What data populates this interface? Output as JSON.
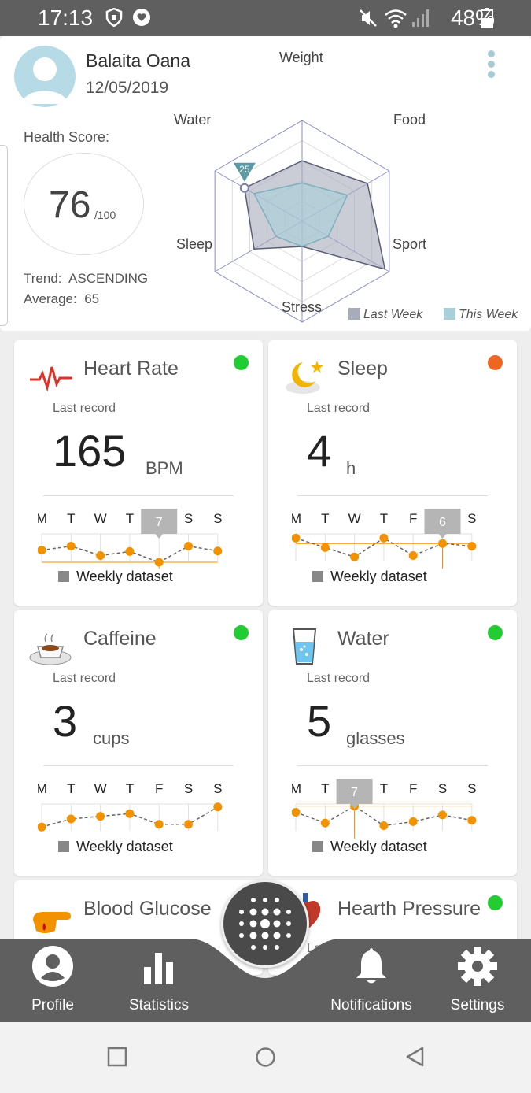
{
  "status_bar": {
    "time": "17:13",
    "battery": "48%"
  },
  "profile": {
    "name": "Balaita Oana",
    "date": "12/05/2019",
    "health_score_label": "Health Score:",
    "score": "76",
    "score_max": "/100",
    "trend_label": "Trend:",
    "trend_value": "ASCENDING",
    "average_label": "Average:",
    "average_value": "65"
  },
  "radar": {
    "axes": [
      "Weight",
      "Food",
      "Sport",
      "Stress",
      "Sleep",
      "Water"
    ],
    "tooltip": "25",
    "legend": [
      {
        "label": "Last Week",
        "color": "#a8acba"
      },
      {
        "label": "This Week",
        "color": "#a9cfd8"
      }
    ],
    "last_week": [
      0.6,
      0.75,
      0.95,
      0.25,
      0.55,
      0.66
    ],
    "this_week": [
      0.38,
      0.52,
      0.3,
      0.25,
      0.3,
      0.55
    ]
  },
  "tiles": [
    {
      "id": "heart-rate",
      "title": "Heart Rate",
      "last": "Last record",
      "value": "165",
      "unit": "BPM",
      "status_color": "#22cc33",
      "days": [
        "M",
        "T",
        "W",
        "T",
        "",
        "S",
        "S"
      ],
      "tooltip": "7",
      "tooltip_index": 4,
      "points": [
        0.45,
        0.6,
        0.25,
        0.4,
        0.0,
        0.6,
        0.42
      ],
      "weekly": "Weekly dataset"
    },
    {
      "id": "sleep",
      "title": "Sleep",
      "last": "Last record",
      "value": "4",
      "unit": "h",
      "status_color": "#ee6622",
      "days": [
        "M",
        "T",
        "W",
        "T",
        "F",
        "",
        "S"
      ],
      "tooltip": "6",
      "tooltip_index": 5,
      "points": [
        0.9,
        0.55,
        0.2,
        0.9,
        0.25,
        0.7,
        0.6
      ],
      "weekly": "Weekly dataset"
    },
    {
      "id": "caffeine",
      "title": "Caffeine",
      "last": "Last record",
      "value": "3",
      "unit": "cups",
      "status_color": "#22cc33",
      "days": [
        "M",
        "T",
        "W",
        "T",
        "F",
        "S",
        "S"
      ],
      "tooltip": "",
      "tooltip_index": -1,
      "points": [
        0.2,
        0.5,
        0.6,
        0.7,
        0.3,
        0.3,
        0.95
      ],
      "weekly": "Weekly dataset"
    },
    {
      "id": "water",
      "title": "Water",
      "last": "Last record",
      "value": "5",
      "unit": "glasses",
      "status_color": "#22cc33",
      "days": [
        "M",
        "T",
        "",
        "T",
        "F",
        "S",
        "S"
      ],
      "tooltip": "7",
      "tooltip_index": 2,
      "points": [
        0.75,
        0.35,
        0.98,
        0.25,
        0.4,
        0.65,
        0.45
      ],
      "weekly": "Weekly dataset"
    }
  ],
  "partial_tiles": [
    {
      "title": "Blood Glucose"
    },
    {
      "title": "Hearth Pressure",
      "status_color": "#22cc33",
      "last_fragment": "La"
    }
  ],
  "bottom_nav": {
    "profile": "Profile",
    "statistics": "Statistics",
    "notifications": "Notifications",
    "settings": "Settings"
  },
  "colors": {
    "accent": "#f39200",
    "bar": "#5f5f5f"
  }
}
